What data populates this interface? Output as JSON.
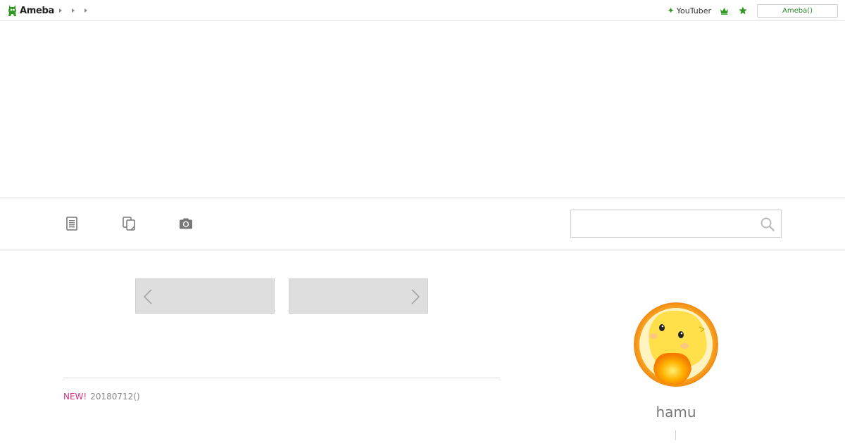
{
  "header": {
    "logo_text": "Ameba",
    "breadcrumbs": [
      "",
      "",
      ""
    ],
    "youtuber_link": "YouTuber",
    "ameba_button": "Ameba()"
  },
  "nav": {
    "icons": [
      "entries-list-icon",
      "theme-icon",
      "camera-icon"
    ],
    "search": {
      "placeholder": "",
      "value": ""
    }
  },
  "pager": {
    "prev_label": "",
    "next_label": ""
  },
  "latest": {
    "badge": "NEW!",
    "title": "20180712()"
  },
  "profile": {
    "name": "hamu"
  },
  "colors": {
    "brand_green": "#2e9a1f",
    "new_badge": "#d6307e",
    "pager_bg": "#dedede",
    "avatar_ring": "#f08a12"
  }
}
